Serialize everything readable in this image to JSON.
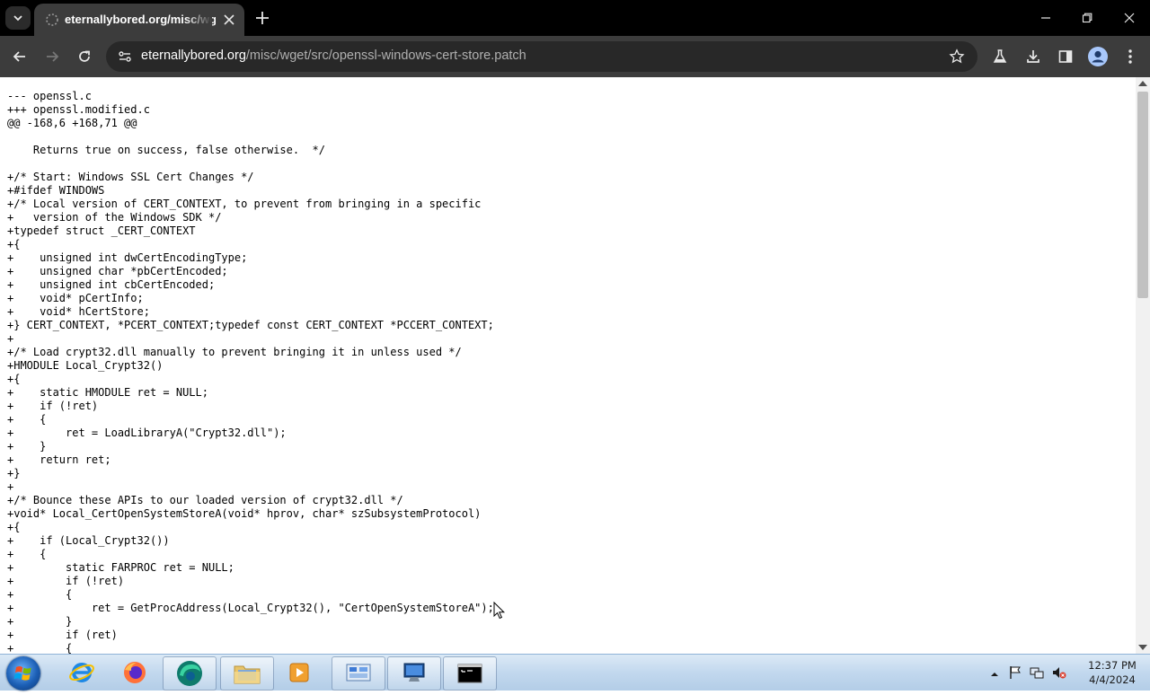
{
  "browser": {
    "tab": {
      "title": "eternallybored.org/misc/wget/src/openssl-windows-cert-store.patch"
    },
    "url": {
      "domain": "eternallybored.org",
      "path": "/misc/wget/src/openssl-windows-cert-store.patch"
    },
    "accent": "#3c3c3c"
  },
  "page": {
    "text": "--- openssl.c\n+++ openssl.modified.c\n@@ -168,6 +168,71 @@\n\n    Returns true on success, false otherwise.  */\n\n+/* Start: Windows SSL Cert Changes */\n+#ifdef WINDOWS\n+/* Local version of CERT_CONTEXT, to prevent from bringing in a specific\n+   version of the Windows SDK */\n+typedef struct _CERT_CONTEXT\n+{\n+    unsigned int dwCertEncodingType;\n+    unsigned char *pbCertEncoded;\n+    unsigned int cbCertEncoded;\n+    void* pCertInfo;\n+    void* hCertStore;\n+} CERT_CONTEXT, *PCERT_CONTEXT;typedef const CERT_CONTEXT *PCCERT_CONTEXT;\n+\n+/* Load crypt32.dll manually to prevent bringing it in unless used */\n+HMODULE Local_Crypt32()\n+{\n+    static HMODULE ret = NULL;\n+    if (!ret)\n+    {\n+        ret = LoadLibraryA(\"Crypt32.dll\");\n+    }\n+    return ret;\n+}\n+\n+/* Bounce these APIs to our loaded version of crypt32.dll */\n+void* Local_CertOpenSystemStoreA(void* hprov, char* szSubsystemProtocol)\n+{\n+    if (Local_Crypt32())\n+    {\n+        static FARPROC ret = NULL;\n+        if (!ret)\n+        {\n+            ret = GetProcAddress(Local_Crypt32(), \"CertOpenSystemStoreA\");\n+        }\n+        if (ret)\n+        {"
  },
  "taskbar": {
    "apps": [
      "internet-explorer",
      "firefox",
      "edge",
      "file-explorer",
      "media-player",
      "control-panel",
      "remote-desktop",
      "command-prompt"
    ],
    "clock": {
      "time": "12:37 PM",
      "date": "4/4/2024"
    }
  }
}
